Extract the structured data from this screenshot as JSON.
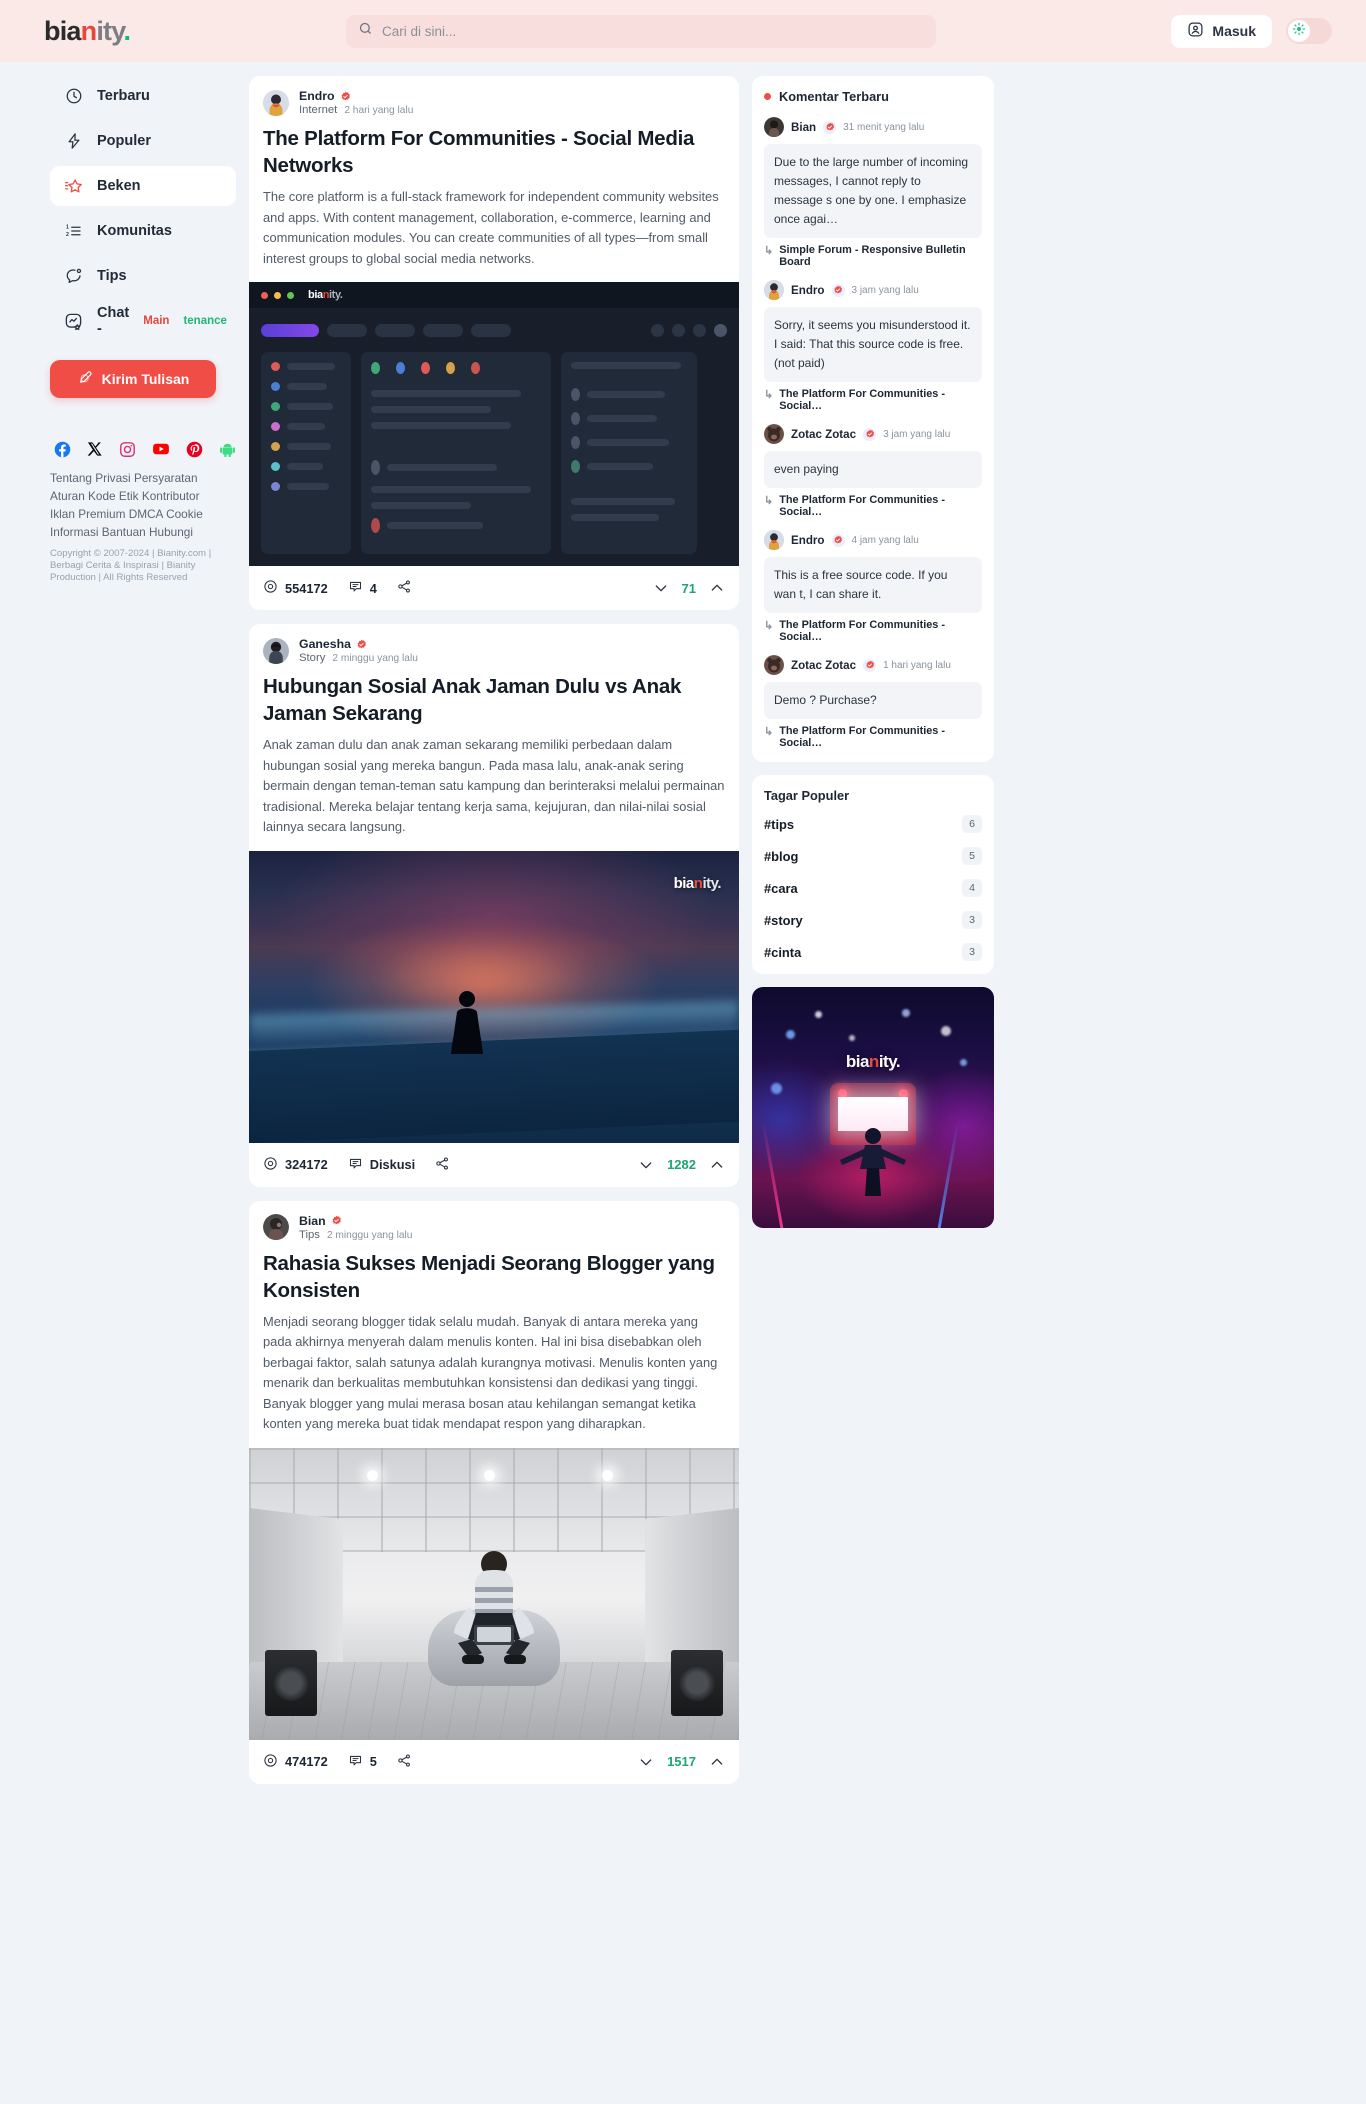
{
  "brand": {
    "part1": "bia",
    "part2": "n",
    "part3": "ity",
    "dot": "."
  },
  "search": {
    "placeholder": "Cari di sini...",
    "value": "",
    "icon": "search-icon"
  },
  "topbar": {
    "login_label": "Masuk",
    "login_icon": "user-circle-icon",
    "theme_icon": "sun-icon"
  },
  "sidebar": {
    "items": [
      {
        "label": "Terbaru",
        "icon": "clock-icon",
        "active": false
      },
      {
        "label": "Populer",
        "icon": "lightning-icon",
        "active": false
      },
      {
        "label": "Beken",
        "icon": "star-sparkle-icon",
        "active": true
      },
      {
        "label": "Komunitas",
        "icon": "ordered-list-icon",
        "active": false
      },
      {
        "label": "Tips",
        "icon": "chat-bubble-icon",
        "active": false
      }
    ],
    "chat": {
      "label": "Chat - ",
      "maintenance_red": "Main",
      "maintenance_green": "tenance",
      "icon": "chat-star-icon"
    },
    "submit_button": {
      "label": "Kirim Tulisan",
      "icon": "pencil-icon"
    },
    "socials": [
      {
        "name": "facebook-icon",
        "color": "#1877f2"
      },
      {
        "name": "x-twitter-icon",
        "color": "#000000"
      },
      {
        "name": "instagram-icon",
        "color": "#e1306c"
      },
      {
        "name": "youtube-icon",
        "color": "#ff0000"
      },
      {
        "name": "pinterest-icon",
        "color": "#e60023"
      },
      {
        "name": "android-icon",
        "color": "#3ddc84"
      }
    ],
    "footer_links": [
      "Tentang",
      "Privasi",
      "Persyaratan",
      "Aturan",
      "Kode Etik",
      "Kontributor",
      "Iklan",
      "Premium",
      "DMCA",
      "Cookie",
      "Informasi",
      "Bantuan",
      "Hubungi"
    ],
    "copyright": "Copyright © 2007-2024 | Bianity.com | Berbagi Cerita & Inspirasi | Bianity Production | All Rights Reserved"
  },
  "feed": {
    "posts": [
      {
        "author": "Endro",
        "verified": true,
        "category": "Internet",
        "time": "2 hari yang lalu",
        "title": "The Platform For Communities - Social Media Networks",
        "body": "The core platform is a full-stack framework for independent community websites and apps. With content management, collaboration, e-commerce, learning and communication modules. You can create communities of all types—from small interest groups to global social media networks.",
        "image_kind": "dashboard-mockup",
        "views": "554172",
        "comments": "4",
        "votes": "71",
        "share_icon": "share-icon"
      },
      {
        "author": "Ganesha",
        "verified": true,
        "category": "Story",
        "time": "2 minggu yang lalu",
        "title": "Hubungan Sosial Anak Jaman Dulu vs Anak Jaman Sekarang",
        "body": "Anak zaman dulu dan anak zaman sekarang memiliki perbedaan dalam hubungan sosial yang mereka bangun. Pada masa lalu, anak-anak sering bermain dengan teman-teman satu kampung dan berinteraksi melalui permainan tradisional. Mereka belajar tentang kerja sama, kejujuran, dan nilai-nilai sosial lainnya secara langsung.",
        "image_kind": "beach-sunset-photo",
        "image_watermark": "bianity.",
        "views": "324172",
        "comments": "Diskusi",
        "votes": "1282",
        "share_icon": "share-icon"
      },
      {
        "author": "Bian",
        "verified": true,
        "category": "Tips",
        "time": "2 minggu yang lalu",
        "title": "Rahasia Sukses Menjadi Seorang Blogger yang Konsisten",
        "body": "Menjadi seorang blogger tidak selalu mudah. Banyak di antara mereka yang pada akhirnya menyerah dalam menulis konten. Hal ini bisa disebabkan oleh berbagai faktor, salah satunya adalah kurangnya motivasi. Menulis konten yang menarik dan berkualitas membutuhkan konsistensi dan dedikasi yang tinggi. Banyak blogger yang mulai merasa bosan atau kehilangan semangat ketika konten yang mereka buat tidak mendapat respon yang diharapkan.",
        "image_kind": "white-room-photo",
        "views": "474172",
        "comments": "5",
        "votes": "1517",
        "share_icon": "share-icon"
      }
    ],
    "icons": {
      "views": "eye-icon",
      "comments": "comment-icon",
      "down": "chevron-down-icon",
      "up": "chevron-up-icon"
    }
  },
  "rail": {
    "comments_title": "Komentar Terbaru",
    "comments": [
      {
        "author": "Bian",
        "time": "31 menit yang lalu",
        "text": "Due to the large number of incoming messages, I cannot reply to message s one by one. I emphasize once agai…",
        "source": "Simple Forum - Responsive Bulletin Board"
      },
      {
        "author": "Endro",
        "time": "3 jam yang lalu",
        "text": "Sorry, it seems you misunderstood it. I said: That this source code is free. (not paid)",
        "source": "The Platform For Communities - Social…"
      },
      {
        "author": "Zotac Zotac",
        "time": "3 jam yang lalu",
        "text": "even paying",
        "source": "The Platform For Communities - Social…"
      },
      {
        "author": "Endro",
        "time": "4 jam yang lalu",
        "text": "This is a free source code. If you wan t, I can share it.",
        "source": "The Platform For Communities - Social…"
      },
      {
        "author": "Zotac Zotac",
        "time": "1 hari yang lalu",
        "text": "Demo ? Purchase?",
        "source": "The Platform For Communities - Social…"
      }
    ],
    "tags_title": "Tagar Populer",
    "tags": [
      {
        "label": "#tips",
        "count": "6"
      },
      {
        "label": "#blog",
        "count": "5"
      },
      {
        "label": "#cara",
        "count": "4"
      },
      {
        "label": "#story",
        "count": "3"
      },
      {
        "label": "#cinta",
        "count": "3"
      }
    ],
    "ad": {
      "logo_1": "bia",
      "logo_2": "n",
      "logo_3": "ity.",
      "alt": "neon-city-night-banner"
    }
  },
  "colors": {
    "accent_red": "#ef4d45",
    "vote_green": "#1ea672",
    "header_bg": "#fbe9e7",
    "page_bg": "#f0f4f9"
  }
}
